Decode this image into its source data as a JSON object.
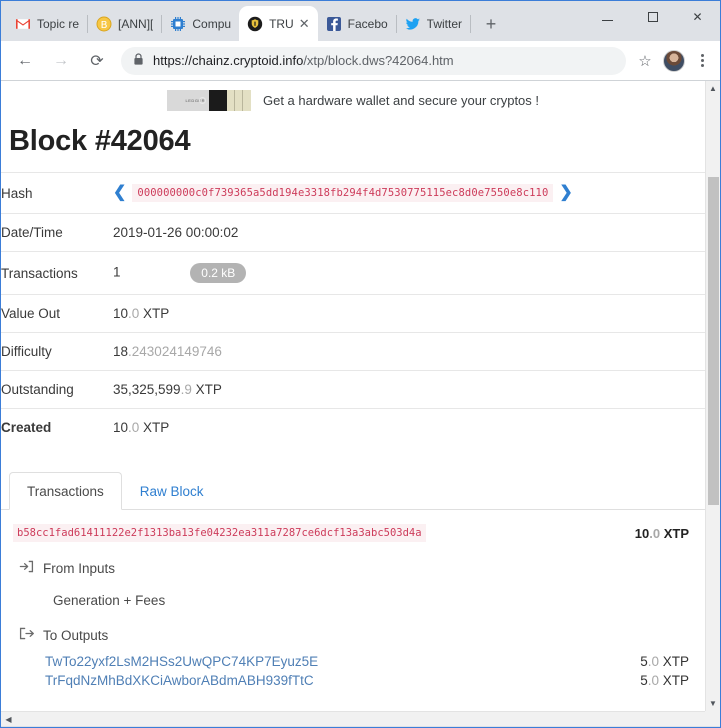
{
  "browser": {
    "tabs": [
      {
        "label": "Topic re",
        "icon": "gmail-icon",
        "active": false
      },
      {
        "label": "[ANN][",
        "icon": "bitcoin-icon",
        "active": false
      },
      {
        "label": "Compu",
        "icon": "chip-icon",
        "active": false
      },
      {
        "label": "TRU",
        "icon": "shield-coin-icon",
        "active": true
      },
      {
        "label": "Facebo",
        "icon": "facebook-icon",
        "active": false
      },
      {
        "label": "Twitter",
        "icon": "twitter-icon",
        "active": false
      }
    ],
    "new_tab_label": "+",
    "window_controls": {
      "minimize": "–",
      "maximize": "□",
      "close": "✕"
    },
    "toolbar": {
      "back": "←",
      "forward": "→",
      "reload": "⟳",
      "url_host": "https://chainz.cryptoid.info",
      "url_path": "/xtp/block.dws?42064.htm",
      "lock_icon": "lock-icon",
      "bookmark": "☆",
      "menu": "⋮"
    }
  },
  "banner": {
    "text": "Get a hardware wallet and secure your cryptos !",
    "device_label": "LEDGER"
  },
  "page": {
    "title": "Block #42064",
    "info_rows": [
      {
        "label": "Hash",
        "type": "hash",
        "value": "000000000c0f739365a5dd194e3318fb294f4d7530775115ec8d0e7550e8c110",
        "prev": "❮",
        "next": "❯",
        "bold": false
      },
      {
        "label": "Date/Time",
        "type": "text",
        "value": "2019-01-26 00:00:02",
        "bold": false
      },
      {
        "label": "Transactions",
        "type": "count",
        "value": "1",
        "badge": "0.2 kB",
        "bold": false
      },
      {
        "label": "Value Out",
        "type": "amount",
        "value_int": "10",
        "value_dec": ".0",
        "unit": " XTP",
        "bold": false
      },
      {
        "label": "Difficulty",
        "type": "amount",
        "value_int": "18",
        "value_dec": ".243024149746",
        "unit": "",
        "bold": false
      },
      {
        "label": "Outstanding",
        "type": "amount",
        "value_int": "35,325,599",
        "value_dec": ".9",
        "unit": " XTP",
        "bold": false
      },
      {
        "label": "Created",
        "type": "amount",
        "value_int": "10",
        "value_dec": ".0",
        "unit": " XTP",
        "bold": true
      }
    ],
    "tabs": [
      {
        "label": "Transactions",
        "active": true
      },
      {
        "label": "Raw Block",
        "active": false
      }
    ],
    "transaction": {
      "hash": "b58cc1fad61411122e2f1313ba13fe04232ea311a7287ce6dcf13a3abc503d4a",
      "amount_int": "10",
      "amount_dec": ".0",
      "amount_unit": " XTP",
      "inputs_label": "From Inputs",
      "inputs_icon": "sign-in-arrow-icon",
      "inputs_detail": "Generation + Fees",
      "outputs_label": "To Outputs",
      "outputs_icon": "sign-out-arrow-icon",
      "outputs": [
        {
          "address": "TwTo22yxf2LsM2HSs2UwQPC74KP7Eyuz5E",
          "amount_int": "5",
          "amount_dec": ".0",
          "amount_unit": " XTP"
        },
        {
          "address": "TrFqdNzMhBdXKCiAwborABdmABH939fTtC",
          "amount_int": "5",
          "amount_dec": ".0",
          "amount_unit": " XTP"
        }
      ]
    }
  },
  "colors": {
    "hash_text": "#cd3b5a",
    "hash_bg": "#fbf0f2",
    "link": "#2f7fd0",
    "address_link": "#4f7fb5",
    "badge_bg": "#b3b3b3",
    "window_border": "#3b7dd8"
  },
  "scrollbars": {
    "up_arrow": "▲",
    "down_arrow": "▼",
    "left_arrow": "◀",
    "right_arrow": "▶"
  }
}
